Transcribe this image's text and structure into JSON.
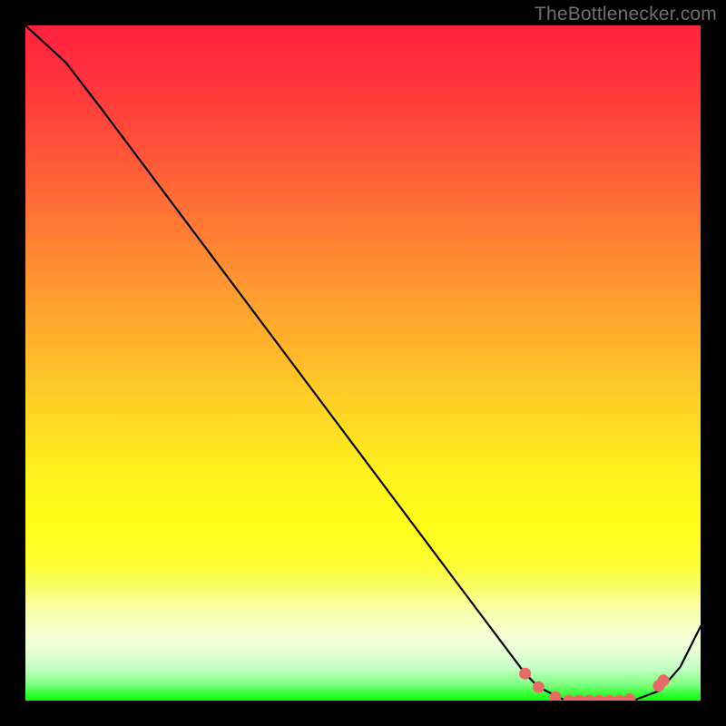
{
  "attribution": "TheBottlenecker.com",
  "chart_data": {
    "type": "line",
    "title": "",
    "xlabel": "",
    "ylabel": "",
    "xlim": [
      0,
      1
    ],
    "ylim": [
      0,
      1
    ],
    "series": [
      {
        "name": "curve",
        "x": [
          0.0,
          0.06,
          0.11,
          0.2,
          0.35,
          0.5,
          0.65,
          0.74,
          0.76,
          0.8,
          0.85,
          0.9,
          0.94,
          0.97,
          1.0
        ],
        "y": [
          1.0,
          0.945,
          0.88,
          0.76,
          0.56,
          0.36,
          0.16,
          0.04,
          0.02,
          0.0,
          0.0,
          0.0,
          0.015,
          0.05,
          0.11
        ]
      }
    ],
    "dots": {
      "x": [
        0.74,
        0.76,
        0.785,
        0.805,
        0.82,
        0.835,
        0.85,
        0.865,
        0.88,
        0.895,
        0.938,
        0.945
      ],
      "y": [
        0.04,
        0.02,
        0.005,
        0.0,
        0.0,
        0.0,
        0.0,
        0.0,
        0.0,
        0.002,
        0.022,
        0.03
      ]
    },
    "dot_color": "#ea6a6a",
    "line_color": "#000000"
  }
}
